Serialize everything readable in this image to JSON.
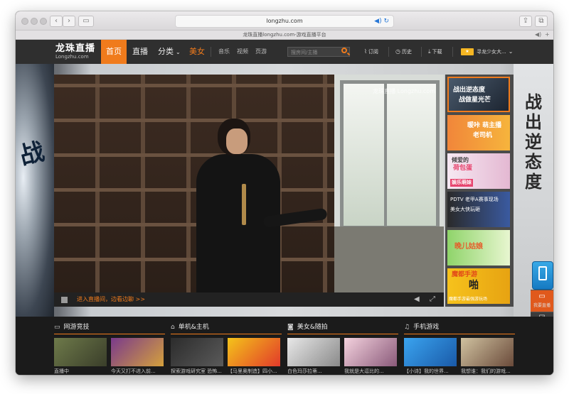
{
  "browser": {
    "url": "longzhu.com",
    "tab_title": "龙珠直播longzhu.com-游戏直播平台"
  },
  "nav": {
    "logo_cn": "龙珠直播",
    "logo_en": "Longzhu.com",
    "items": [
      "首页",
      "直播",
      "分类",
      "美女"
    ],
    "small_items": [
      "音乐",
      "视频",
      "页游"
    ],
    "search_placeholder": "搜房间/主播",
    "subscribe": "订阅",
    "history": "历史",
    "download": "下载",
    "user_name": "寻龙少女大..."
  },
  "banner": {
    "right_text": "战出逆态度",
    "left_text": "战"
  },
  "video": {
    "watermark": "龙珠直播 Longzhu.com",
    "enter_room": "进入直播间，边看边聊 >>"
  },
  "thumbs": [
    {
      "line1": "战出逆态度",
      "line2": "战做星光芒"
    },
    {
      "line1": "暖咔 萌主播",
      "line2": "老司机"
    },
    {
      "line1": "倾爱的",
      "line2": "荷包蛋",
      "line3": "娱乐萌妹"
    },
    {
      "line1": "PDTV 老甲A赛事现场",
      "line2": "美女大侠玩砸"
    },
    {
      "line1": "晚儿姑娘",
      "line2": ""
    },
    {
      "line1": "魔都手游",
      "line2": "啪",
      "line3": "魔都手游最强游玩场"
    }
  ],
  "float": {
    "live": "我要直播",
    "sign": "签到",
    "service": "客服"
  },
  "sections": [
    {
      "title": "网游竞技",
      "captions": [
        "直播中",
        "今天又打不进入前..."
      ]
    },
    {
      "title": "单机&主机",
      "captions": [
        "探索游戏研究室 恐怖...",
        "【马里奥制造】四小..."
      ]
    },
    {
      "title": "美女&随拍",
      "captions": [
        "白色玛莎拉蒂...",
        "我就是大逗比的..."
      ]
    },
    {
      "title": "手机游戏",
      "captions": [
        "【小诗】我的世界...",
        "我想谁：我们的游戏..."
      ]
    }
  ],
  "colors": {
    "accent": "#f07b1c",
    "nav_bg": "#2f2f2f",
    "bottom_bg": "#1b1b1b"
  }
}
